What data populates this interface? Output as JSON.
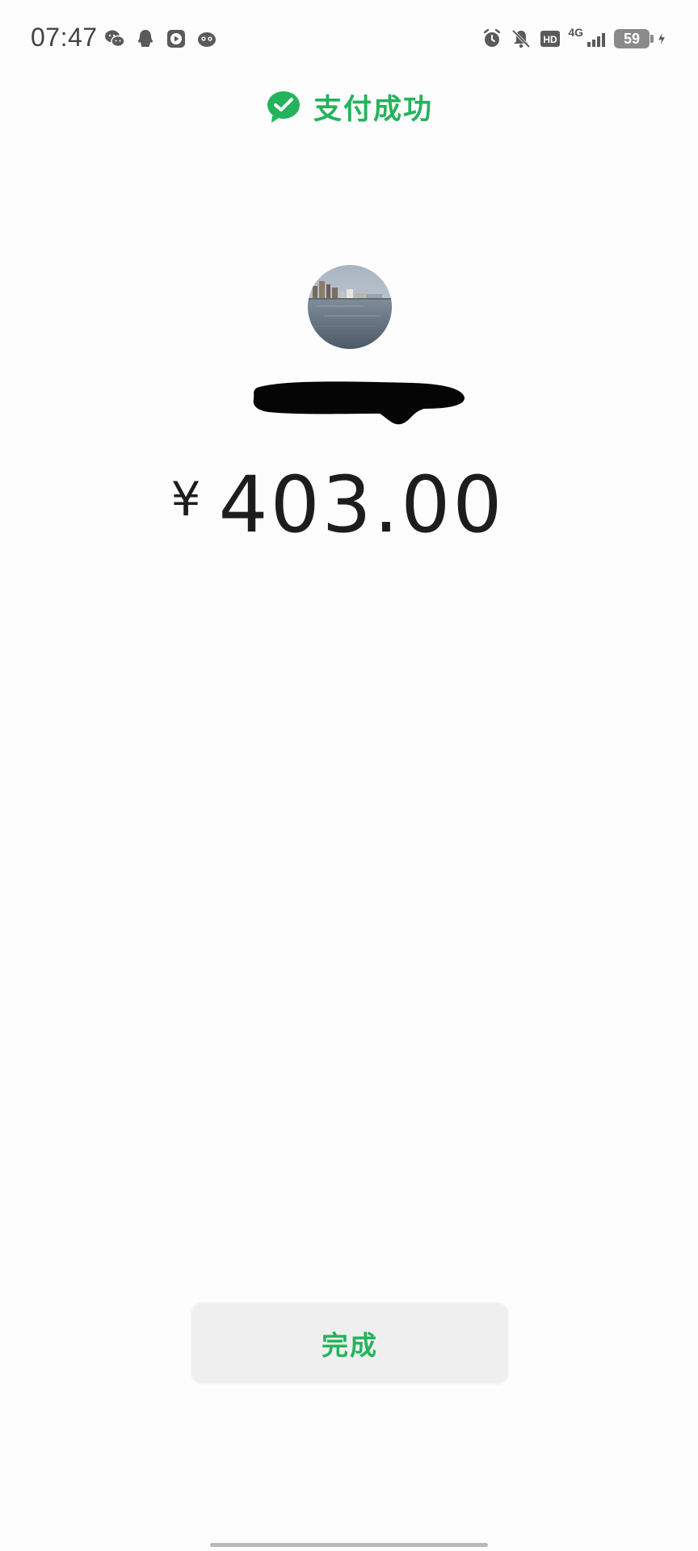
{
  "status_bar": {
    "time": "07:47",
    "left_icons": [
      "wechat-icon",
      "qq-icon",
      "video-player-icon",
      "app-mascot-icon"
    ],
    "right_icons": [
      "alarm-icon",
      "mute-bell-icon",
      "hd-icon",
      "signal-4g-icon",
      "battery-icon",
      "charging-icon"
    ],
    "network_label": "4G",
    "battery_level": "59"
  },
  "header": {
    "title": "支付成功",
    "icon": "payment-success-check-icon",
    "accent_color": "#24b35c"
  },
  "payee": {
    "avatar_icon": "avatar-lake-skyline-image",
    "name_redacted": true
  },
  "amount": {
    "currency": "¥",
    "value": "403.00"
  },
  "actions": {
    "done_label": "完成"
  }
}
